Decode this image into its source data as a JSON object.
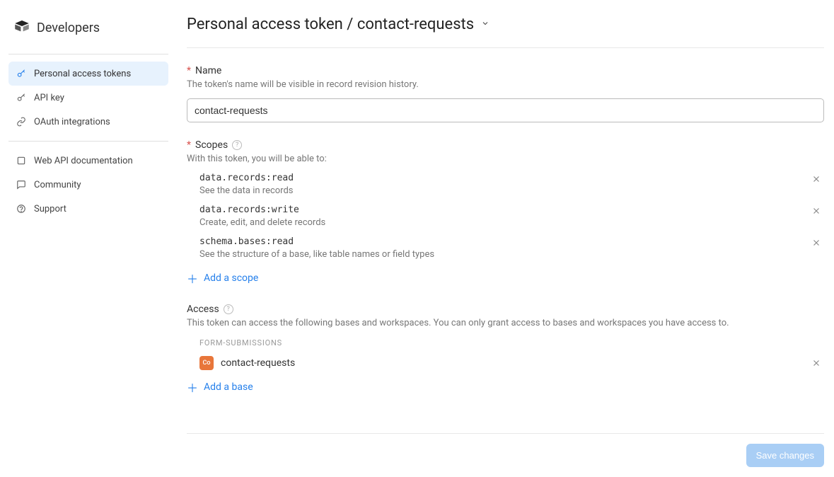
{
  "brand": {
    "name": "Developers"
  },
  "sidebar": {
    "groups": [
      {
        "items": [
          {
            "label": "Personal access tokens",
            "active": true,
            "icon": "key"
          },
          {
            "label": "API key",
            "active": false,
            "icon": "key2"
          },
          {
            "label": "OAuth integrations",
            "active": false,
            "icon": "link"
          }
        ]
      },
      {
        "items": [
          {
            "label": "Web API documentation",
            "active": false,
            "icon": "book"
          },
          {
            "label": "Community",
            "active": false,
            "icon": "chat"
          },
          {
            "label": "Support",
            "active": false,
            "icon": "help"
          }
        ]
      }
    ]
  },
  "header": {
    "breadcrumb_parent": "Personal access token",
    "breadcrumb_separator": "/",
    "breadcrumb_current": "contact-requests"
  },
  "form": {
    "name_label": "Name",
    "name_help": "The token's name will be visible in record revision history.",
    "name_value": "contact-requests",
    "scopes_label": "Scopes",
    "scopes_help": "With this token, you will be able to:",
    "scopes": [
      {
        "code": "data.records:read",
        "desc": "See the data in records"
      },
      {
        "code": "data.records:write",
        "desc": "Create, edit, and delete records"
      },
      {
        "code": "schema.bases:read",
        "desc": "See the structure of a base, like table names or field types"
      }
    ],
    "add_scope_label": "Add a scope",
    "access_label": "Access",
    "access_help": "This token can access the following bases and workspaces. You can only grant access to bases and workspaces you have access to.",
    "workspace_label": "FORM-SUBMISSIONS",
    "bases": [
      {
        "name": "contact-requests",
        "icon_label": "Co"
      }
    ],
    "add_base_label": "Add a base"
  },
  "footer": {
    "save_label": "Save changes"
  }
}
